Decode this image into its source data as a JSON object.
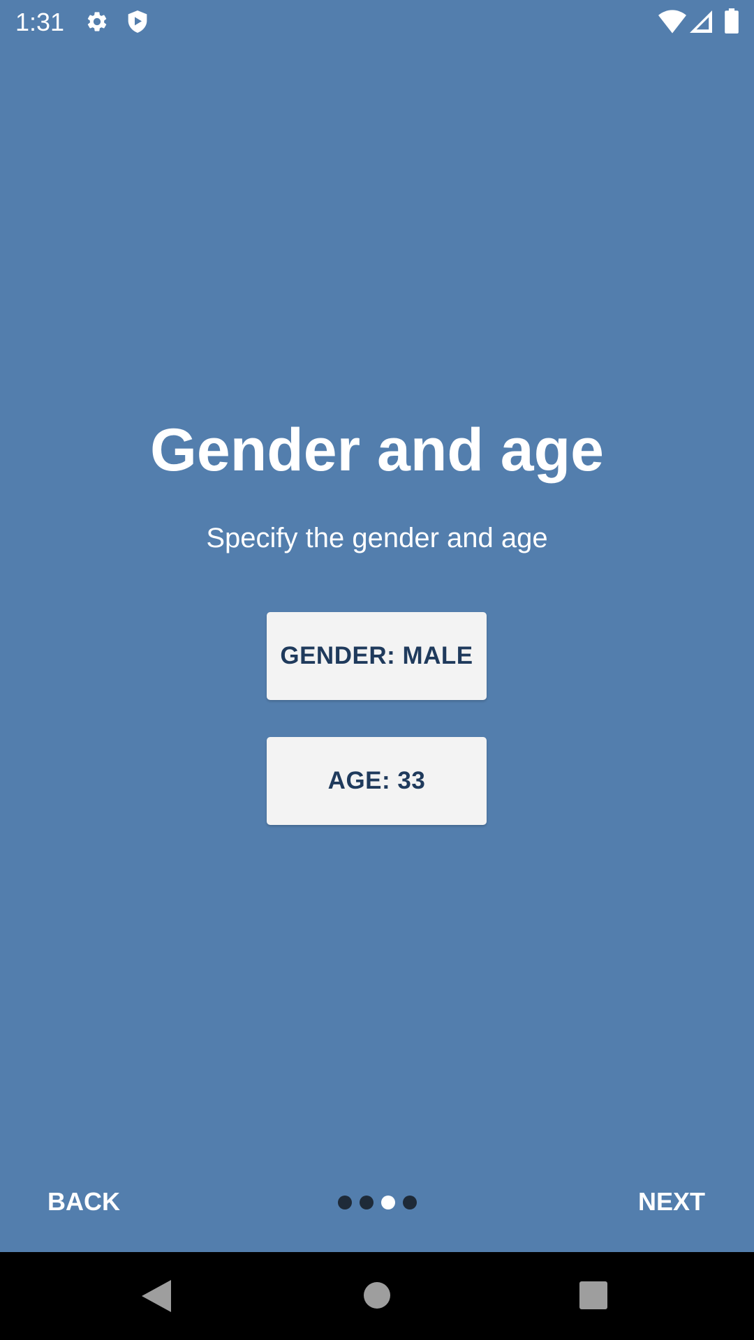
{
  "status_bar": {
    "time": "1:31",
    "icons": [
      "gear-icon",
      "shield-icon",
      "wifi-icon",
      "signal-icon",
      "battery-icon"
    ]
  },
  "content": {
    "title": "Gender and age",
    "subtitle": "Specify the gender and age",
    "gender_button_label": "GENDER: MALE",
    "age_button_label": "AGE: 33"
  },
  "footer": {
    "back_label": "BACK",
    "next_label": "NEXT",
    "page_indicator": {
      "total": 4,
      "current": 3
    }
  },
  "system_nav": {
    "icons": [
      "back-triangle-icon",
      "home-circle-icon",
      "recents-square-icon"
    ]
  },
  "colors": {
    "background": "#537ead",
    "button_background": "#f3f3f3",
    "button_text": "#1f3a5c",
    "dot_inactive": "#1e2a38",
    "dot_active": "#ffffff"
  }
}
